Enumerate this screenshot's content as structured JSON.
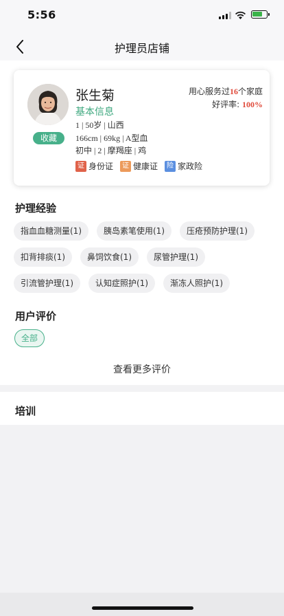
{
  "status_bar": {
    "time": "5:56"
  },
  "nav": {
    "title": "护理员店铺"
  },
  "profile": {
    "name": "张生菊",
    "basic_info_label": "基本信息",
    "info_line_1": "1 | 50岁 | 山西",
    "info_line_2": "166cm | 69kg | A型血",
    "info_line_3": "初中 | 2 | 摩羯座 | 鸡",
    "favorite_label": "收藏",
    "served_prefix": "用心服务过",
    "served_count": "16",
    "served_suffix": "个家庭",
    "rating_label": "好评率:",
    "rating_value": "100%",
    "certificates": [
      {
        "badge": "证",
        "label": "身份证",
        "color": "#e0624a"
      },
      {
        "badge": "证",
        "label": "健康证",
        "color": "#ec9a5a"
      },
      {
        "badge": "险",
        "label": "家政险",
        "color": "#5b8fe0"
      }
    ]
  },
  "experience": {
    "title": "护理经验",
    "rows": [
      [
        "指血血糖测量(1)",
        "胰岛素笔使用(1)",
        "压疮预防护理(1)"
      ],
      [
        "扣背排痰(1)",
        "鼻饲饮食(1)",
        "尿管护理(1)"
      ],
      [
        "引流管护理(1)",
        "认知症照护(1)",
        "渐冻人照护(1)"
      ]
    ]
  },
  "reviews": {
    "title": "用户评价",
    "filter_all": "全部",
    "more_label": "查看更多评价"
  },
  "training": {
    "title": "培训"
  },
  "colors": {
    "accent_green": "#47b08a",
    "highlight_red": "#e04a3a"
  }
}
